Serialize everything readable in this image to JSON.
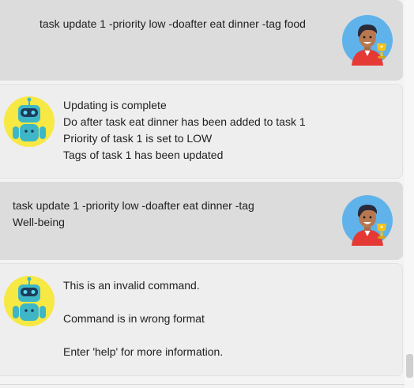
{
  "messages": [
    {
      "sender": "user",
      "avatar": "user-avatar-icon",
      "text": "task update 1 -priority low -doafter eat dinner -tag food"
    },
    {
      "sender": "bot",
      "avatar": "robot-avatar-icon",
      "text": "Updating is complete\nDo after task eat dinner has been added to task 1\nPriority of task 1 is set to LOW\nTags of task 1 has been updated"
    },
    {
      "sender": "user",
      "avatar": "user-avatar-icon",
      "text": "task update 1 -priority low -doafter eat dinner -tag\nWell-being"
    },
    {
      "sender": "bot",
      "avatar": "robot-avatar-icon",
      "text": "This is an invalid command.\n\nCommand is in wrong format\n\nEnter 'help' for more information."
    }
  ],
  "colors": {
    "user_bubble": "#dcdcdc",
    "bot_bubble": "#eeeeee",
    "user_avatar_bg": "#5fb3ea",
    "robot_avatar_bg": "#f7e843",
    "robot_body": "#3fb6c6",
    "trophy": "#f5c21b",
    "shirt": "#e53935"
  }
}
